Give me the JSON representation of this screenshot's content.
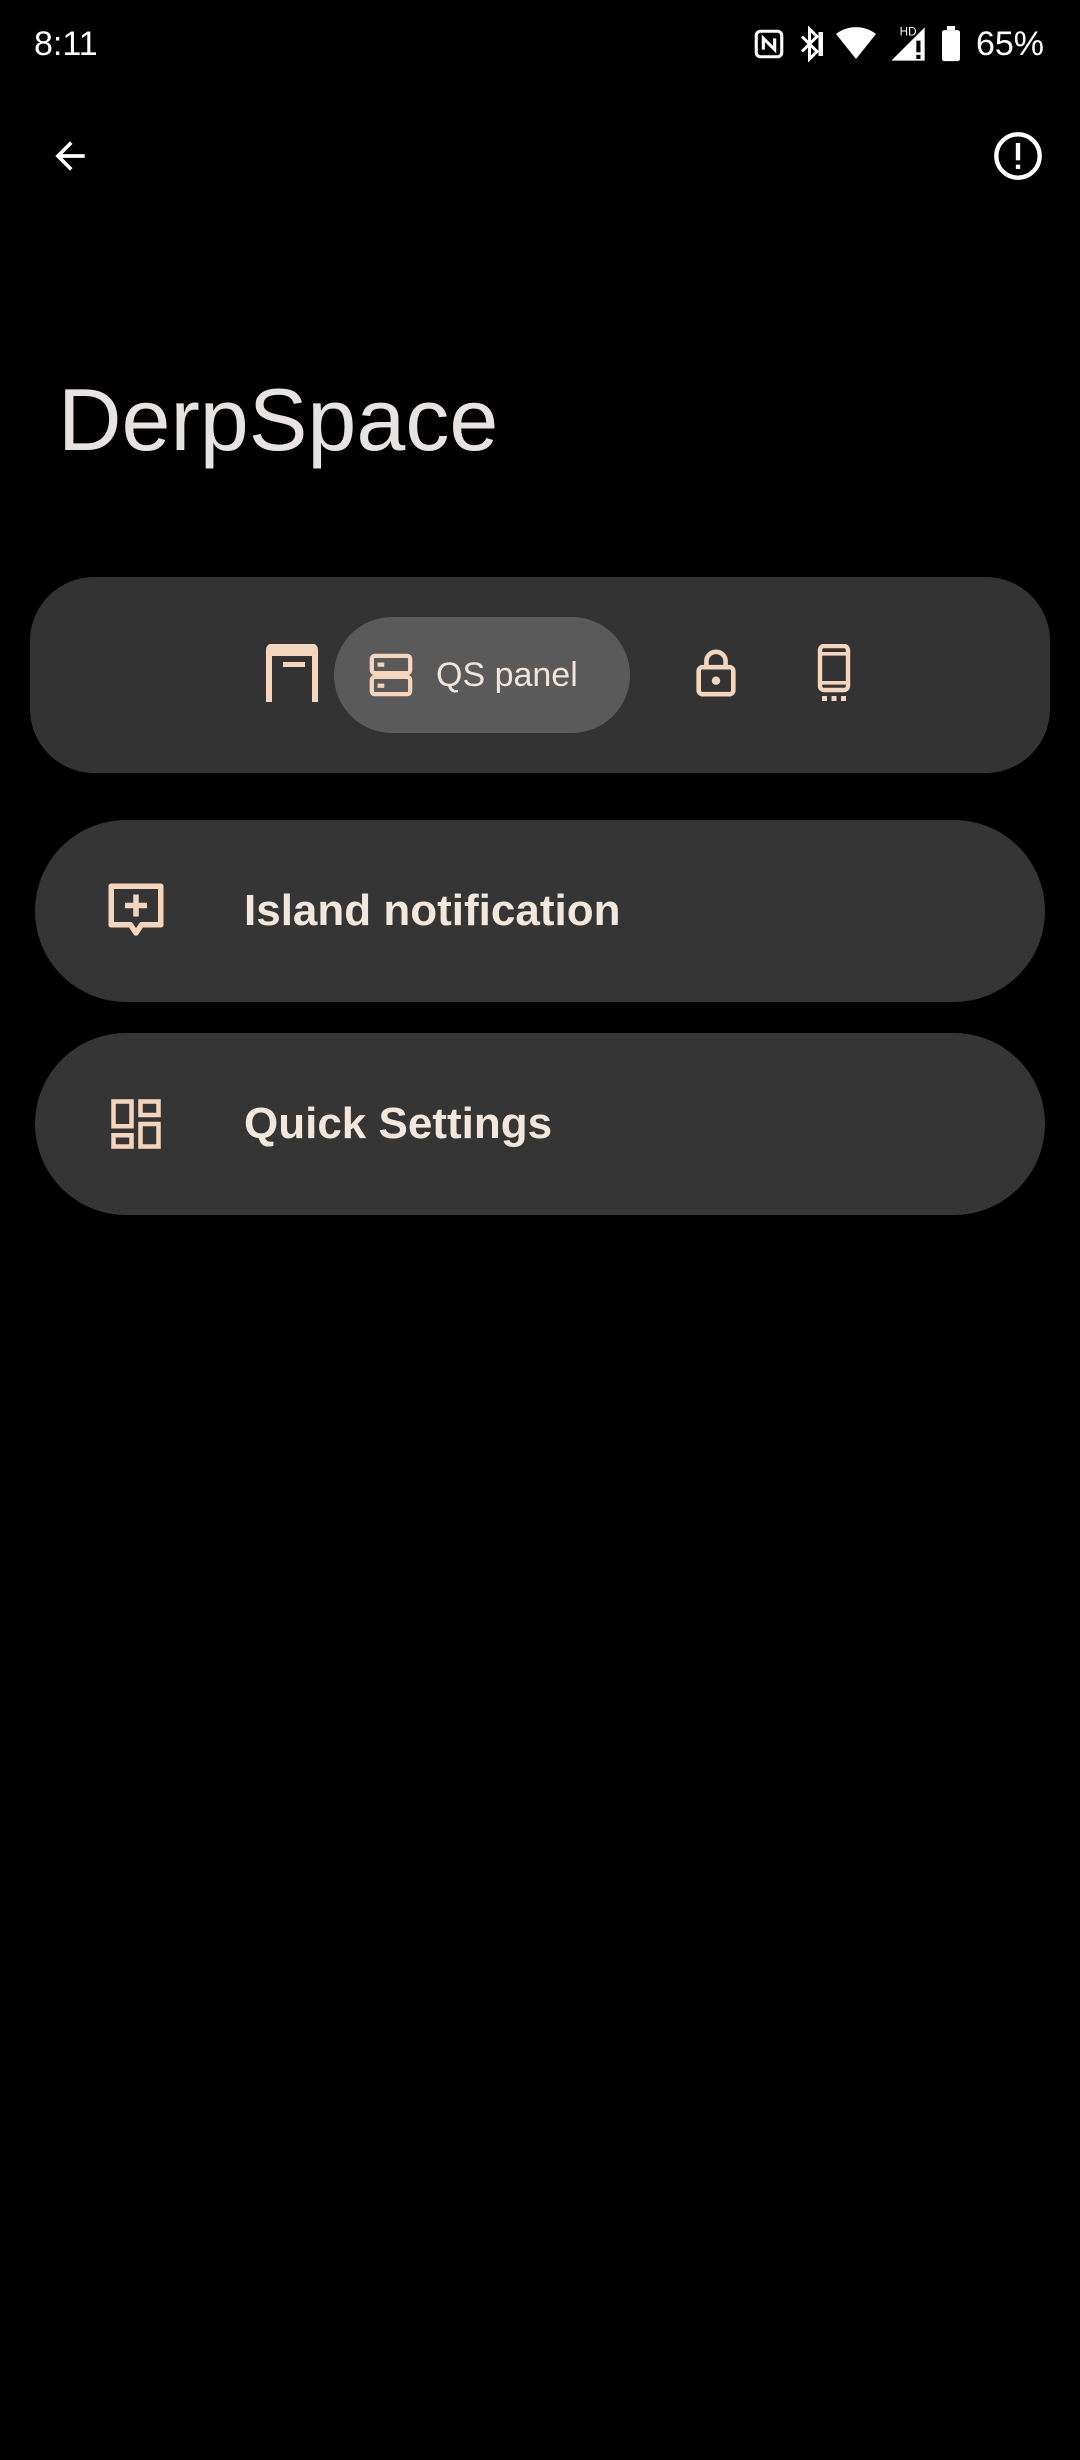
{
  "status_bar": {
    "time": "8:11",
    "battery": "65%",
    "icons": [
      "nfc-icon",
      "bluetooth-icon",
      "wifi-icon",
      "signal-icon",
      "battery-icon"
    ],
    "signal_label": "HD"
  },
  "top_bar": {
    "back_icon": "back-arrow-icon",
    "info_icon": "info-alert-icon"
  },
  "page": {
    "title": "DerpSpace"
  },
  "segments": {
    "items": [
      {
        "icon": "statusbar-icon",
        "label": "",
        "selected": false
      },
      {
        "icon": "qs-panel-icon",
        "label": "QS panel",
        "selected": true
      },
      {
        "icon": "lock-icon",
        "label": "",
        "selected": false
      },
      {
        "icon": "phone-icon",
        "label": "",
        "selected": false
      }
    ]
  },
  "menu": {
    "items": [
      {
        "icon": "message-add-icon",
        "label": "Island notification"
      },
      {
        "icon": "dashboard-icon",
        "label": "Quick Settings"
      }
    ]
  },
  "colors": {
    "background": "#000000",
    "surface": "#353535",
    "segment_selected": "#5a5a5a",
    "accent": "#f5d6bd",
    "title_text": "#e8e3e0"
  }
}
